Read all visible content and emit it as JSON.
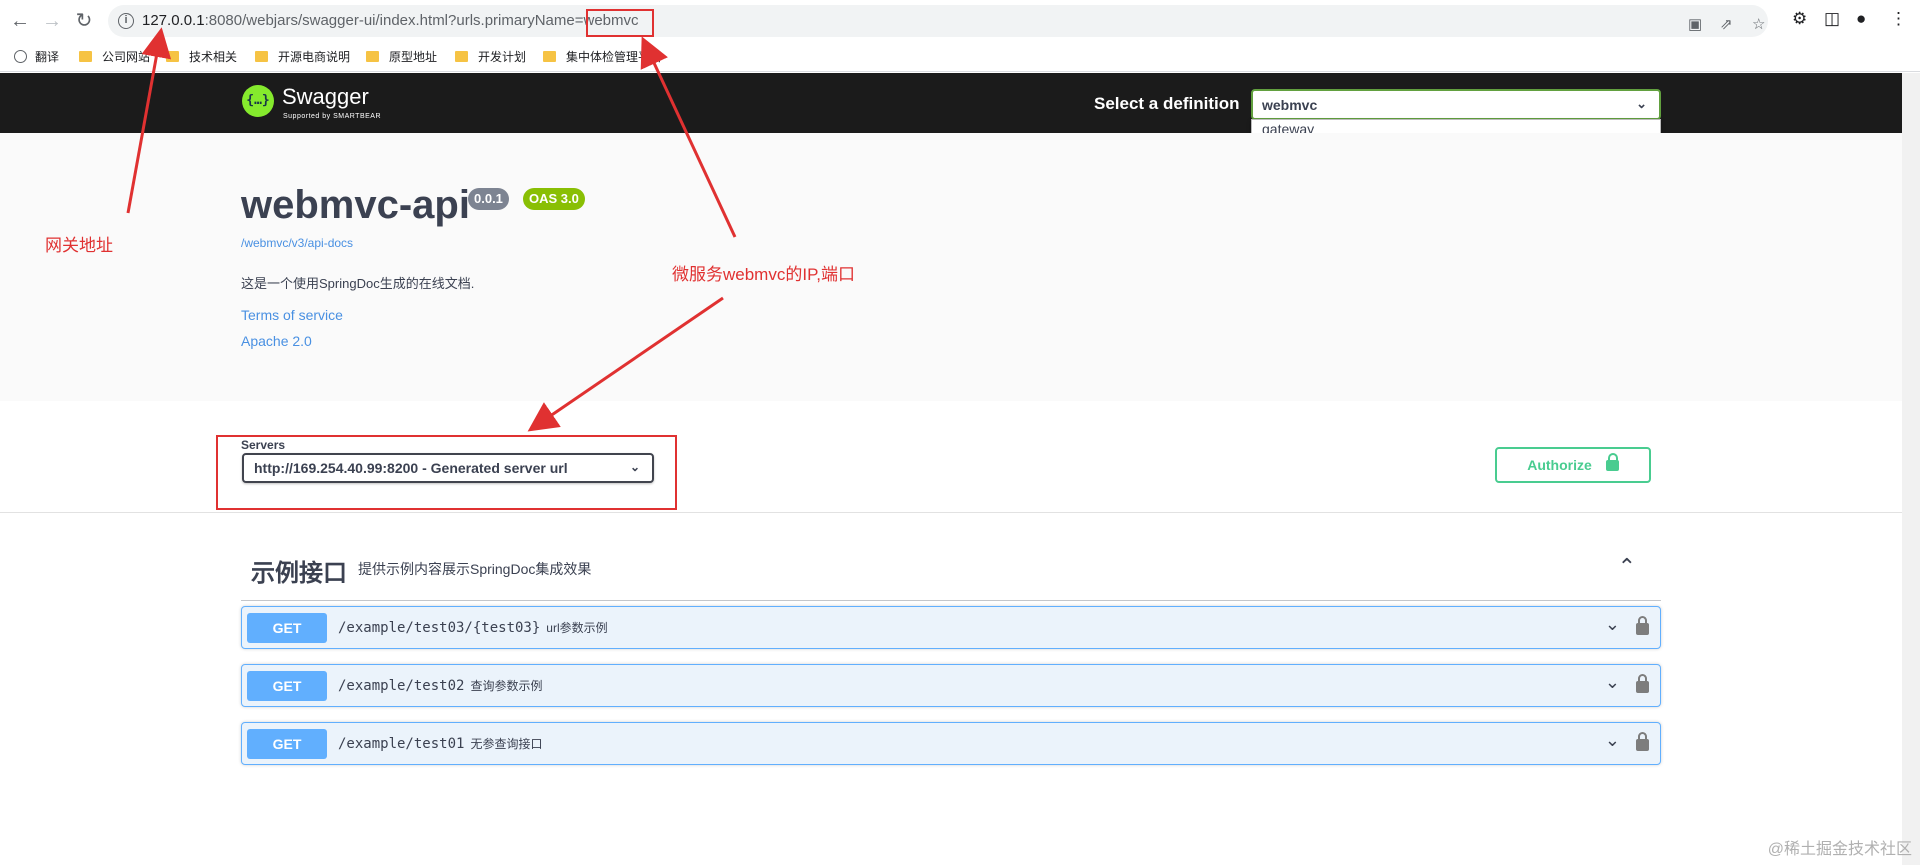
{
  "browser": {
    "url_host": "127.0.0.1",
    "url_rest": ":8080/webjars/swagger-ui/index.html?urls.primaryName=",
    "url_highlight": "webmvc",
    "bookmarks": [
      "翻译",
      "公司网站",
      "技术相关",
      "开源电商说明",
      "原型地址",
      "开发计划",
      "集中体检管理平台"
    ]
  },
  "topbar": {
    "logo_glyph": "{…}",
    "logo_text": "Swagger",
    "logo_sub": "Supported by SMARTBEAR",
    "select_label": "Select a definition",
    "selected": "webmvc",
    "options": [
      "gateway",
      "webmvc"
    ]
  },
  "info": {
    "title": "webmvc-api",
    "version": "0.0.1",
    "oas": "OAS 3.0",
    "spec_link": "/webmvc/v3/api-docs",
    "description": "这是一个使用SpringDoc生成的在线文档.",
    "terms": "Terms of service",
    "license": "Apache 2.0"
  },
  "servers": {
    "label": "Servers",
    "selected": "http://169.254.40.99:8200 - Generated server url"
  },
  "authorize": {
    "label": "Authorize"
  },
  "tag": {
    "name": "示例接口",
    "description": "提供示例内容展示SpringDoc集成效果"
  },
  "operations": [
    {
      "method": "GET",
      "path": "/example/test03/{test03}",
      "summary": "url参数示例"
    },
    {
      "method": "GET",
      "path": "/example/test02",
      "summary": "查询参数示例"
    },
    {
      "method": "GET",
      "path": "/example/test01",
      "summary": "无参查询接口"
    }
  ],
  "annotations": {
    "gateway": "网关地址",
    "microservice": "微服务webmvc的IP,端口"
  },
  "watermark": "@稀土掘金技术社区",
  "colors": {
    "get": "#61affe",
    "authorize": "#49cc90",
    "topbar": "#1b1b1b",
    "logo": "#85ea2d",
    "annotation": "#e03131",
    "selected_option": "#1e6bd6"
  }
}
